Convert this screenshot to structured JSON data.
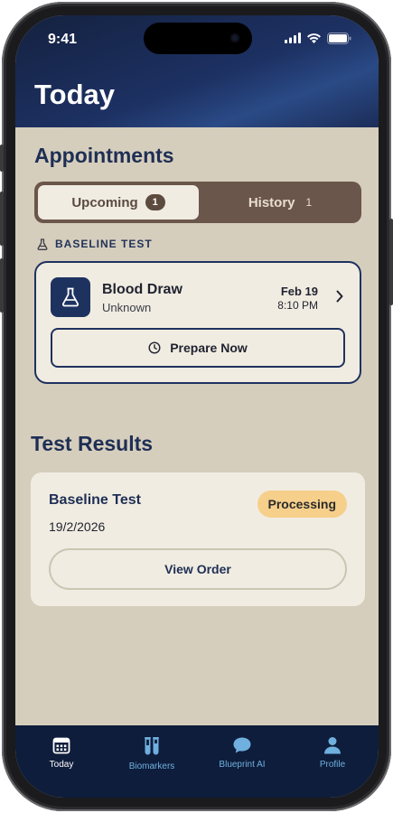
{
  "status_bar": {
    "time": "9:41"
  },
  "header": {
    "title": "Today"
  },
  "appointments": {
    "title": "Appointments",
    "segments": [
      {
        "label": "Upcoming",
        "count": "1",
        "active": true
      },
      {
        "label": "History",
        "count": "1",
        "active": false
      }
    ],
    "group_label": "BASELINE TEST",
    "card": {
      "name": "Blood Draw",
      "subtitle": "Unknown",
      "date": "Feb 19",
      "time": "8:10 PM",
      "button_label": "Prepare Now"
    }
  },
  "test_results": {
    "title": "Test Results",
    "card": {
      "name": "Baseline Test",
      "date": "19/2/2026",
      "status": "Processing",
      "button_label": "View Order"
    }
  },
  "tab_bar": {
    "items": [
      {
        "label": "Today",
        "icon": "calendar-icon",
        "active": true
      },
      {
        "label": "Biomarkers",
        "icon": "test-tubes-icon",
        "active": false
      },
      {
        "label": "Blueprint AI",
        "icon": "chat-bubble-icon",
        "active": false
      },
      {
        "label": "Profile",
        "icon": "person-icon",
        "active": false
      }
    ]
  },
  "colors": {
    "navy": "#1e3260",
    "background": "#d6cebc",
    "card": "#f1ece1",
    "segment_track": "#6b564b",
    "badge": "#f6cf8b",
    "tab_active": "#ffffff",
    "tab_inactive": "#6fb0df"
  }
}
